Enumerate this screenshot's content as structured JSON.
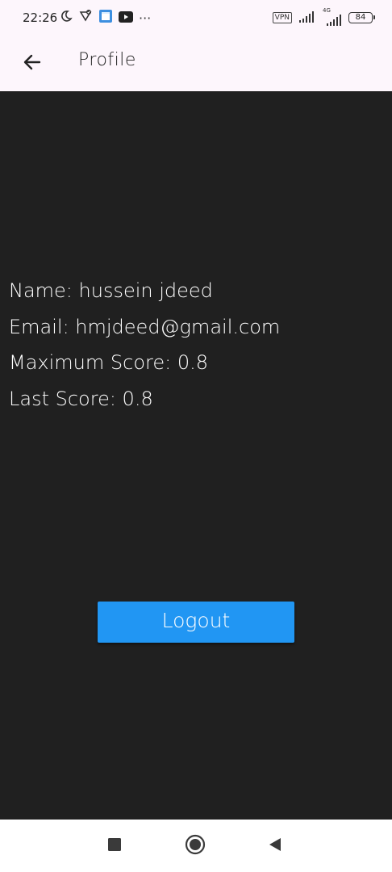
{
  "status_bar": {
    "time": "22:26",
    "left_icons": [
      "moon-icon",
      "location-shield-icon",
      "calendar-app-icon",
      "youtube-icon",
      "more-dots-icon"
    ],
    "more": "···",
    "vpn": "VPN",
    "network": "4G",
    "battery": "84"
  },
  "app_bar": {
    "title": "Profile"
  },
  "profile": {
    "name_line": "Name: hussein jdeed",
    "email_line": "Email: hmjdeed@gmail.com",
    "max_score_line": "Maximum Score: 0.8",
    "last_score_line": "Last Score: 0.8"
  },
  "actions": {
    "logout_label": "Logout"
  },
  "colors": {
    "app_bar_bg": "#fdf6fc",
    "content_bg": "#202020",
    "button_blue": "#2196f3",
    "text_white": "#ffffff"
  },
  "nav_bar": {
    "items": [
      "recents-square-icon",
      "home-circle-icon",
      "back-triangle-icon"
    ]
  }
}
